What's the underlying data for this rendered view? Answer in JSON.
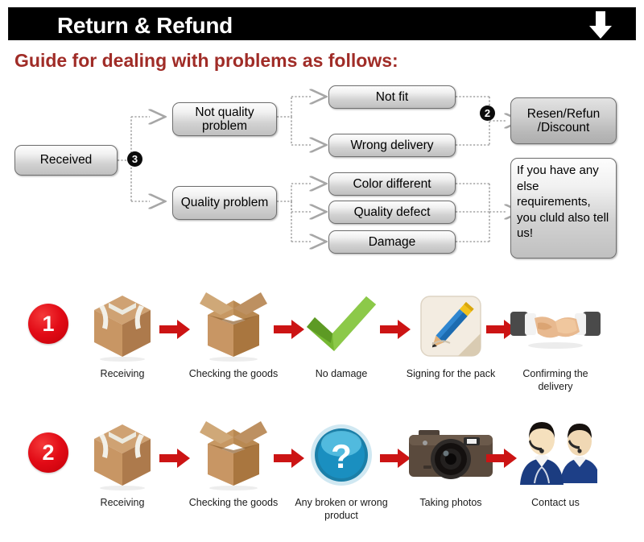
{
  "header": {
    "title": "Return & Refund",
    "arrow_icon": "down-arrow-icon"
  },
  "guide_heading": "Guide for dealing with problems as follows:",
  "colors": {
    "header_bg": "#000000",
    "header_text": "#ffffff",
    "guide_text": "#a02c27",
    "badge_red": "#e20b16",
    "arrow_red": "#cc1414",
    "node_border": "#6f6f6f",
    "connector": "#9a9a9a",
    "check_green": "#73b832",
    "box_brown": "#c08f5e"
  },
  "flowchart": {
    "start": {
      "label": "Received"
    },
    "badge_3": "3",
    "badge_2": "2",
    "categories": [
      {
        "label": "Not quality problem"
      },
      {
        "label": "Quality problem"
      }
    ],
    "issues": [
      {
        "label": "Not fit"
      },
      {
        "label": "Wrong delivery"
      },
      {
        "label": "Color different"
      },
      {
        "label": "Quality defect"
      },
      {
        "label": "Damage"
      }
    ],
    "outcomes": [
      {
        "label": "Resen/Refun\n/Discount"
      },
      {
        "label": "If you have any else requirements, you cluld also tell us!"
      }
    ]
  },
  "process_rows": [
    {
      "number": "1",
      "steps": [
        {
          "label": "Receiving",
          "icon": "sealed-box-icon"
        },
        {
          "label": "Checking the goods",
          "icon": "open-box-icon"
        },
        {
          "label": "No damage",
          "icon": "green-checkmark-icon"
        },
        {
          "label": "Signing for the pack",
          "icon": "pencil-signing-icon"
        },
        {
          "label": "Confirming the delivery",
          "icon": "handshake-icon"
        }
      ]
    },
    {
      "number": "2",
      "steps": [
        {
          "label": "Receiving",
          "icon": "sealed-box-icon"
        },
        {
          "label": "Checking the goods",
          "icon": "open-box-icon"
        },
        {
          "label": "Any broken or wrong product",
          "icon": "question-mark-icon"
        },
        {
          "label": "Taking photos",
          "icon": "camera-icon"
        },
        {
          "label": "Contact us",
          "icon": "support-agents-icon"
        }
      ]
    }
  ]
}
